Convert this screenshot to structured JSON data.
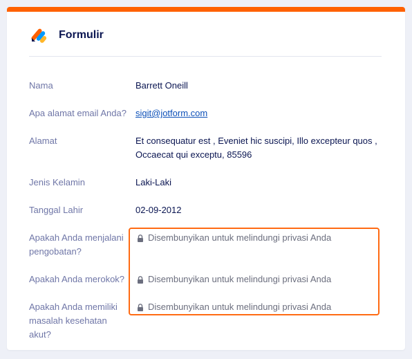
{
  "form": {
    "title": "Formulir"
  },
  "fields": {
    "name": {
      "label": "Nama",
      "value": "Barrett Oneill"
    },
    "email": {
      "label": "Apa alamat email Anda?",
      "value": "sigit@jotform.com"
    },
    "address": {
      "label": "Alamat",
      "line1": "Et consequatur est , Eveniet hic suscipi, Illo excepteur quos ,",
      "line2": "Occaecat qui exceptu, 85596"
    },
    "gender": {
      "label": "Jenis Kelamin",
      "value": "Laki-Laki"
    },
    "birthdate": {
      "label": "Tanggal Lahir",
      "value": "02-09-2012"
    },
    "treatment": {
      "label_line1": "Apakah Anda menjalani",
      "label_line2": "pengobatan?",
      "value": "Disembunyikan untuk melindungi privasi Anda"
    },
    "smoking": {
      "label": "Apakah Anda merokok?",
      "value": "Disembunyikan untuk melindungi privasi Anda"
    },
    "acute_health": {
      "label_line1": "Apakah Anda memiliki",
      "label_line2": "masalah kesehatan akut?",
      "value": "Disembunyikan untuk melindungi privasi Anda"
    }
  },
  "icons": {
    "logo": "jotform-logo-icon",
    "lock": "lock-icon"
  },
  "colors": {
    "accent": "#ff6100",
    "highlight_border": "#ff6a12",
    "title": "#0a1551",
    "label": "#6f76a7",
    "link": "#0b4fb8",
    "page_background": "#eef0f7",
    "logo_orange": "#ff6100",
    "logo_blue": "#0099ff",
    "logo_yellow": "#ffb629",
    "logo_navy": "#0a1551"
  }
}
